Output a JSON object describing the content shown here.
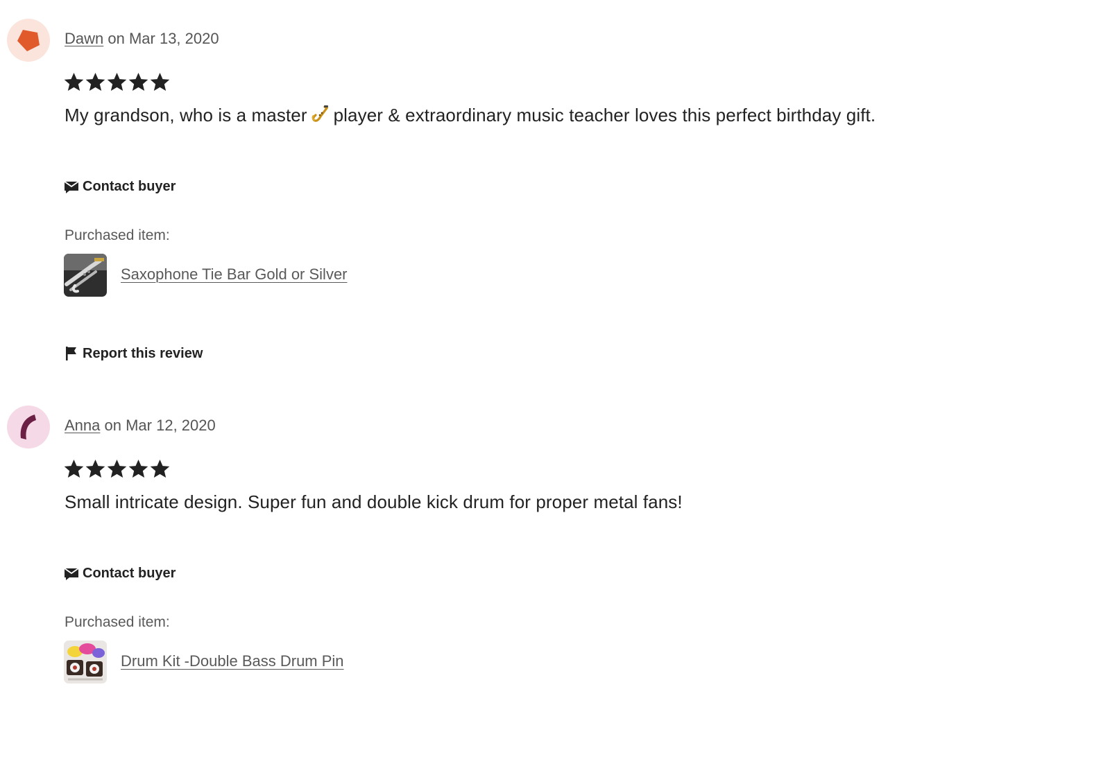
{
  "reviews": [
    {
      "reviewer": "Dawn",
      "date_text": "on Mar 13, 2020",
      "rating": 5,
      "text_before_icon": "My grandson, who is a master",
      "text_icon": "saxophone-emoji",
      "text_after_icon": "player & extraordinary music teacher loves this perfect birthday gift.",
      "contact_label": "Contact buyer",
      "purchased_label": "Purchased item:",
      "item_title": "Saxophone Tie Bar Gold or Silver",
      "report_label": "Report this review",
      "avatar_color": "#e05a2b",
      "avatar_bg": "#fbe4dc"
    },
    {
      "reviewer": "Anna",
      "date_text": "on Mar 12, 2020",
      "rating": 5,
      "text": "Small intricate design. Super fun and double kick drum for proper metal fans!",
      "contact_label": "Contact buyer",
      "purchased_label": "Purchased item:",
      "item_title": "Drum Kit -Double Bass Drum Pin",
      "avatar_color": "#6b1f45",
      "avatar_bg": "#f6d9e6"
    }
  ]
}
